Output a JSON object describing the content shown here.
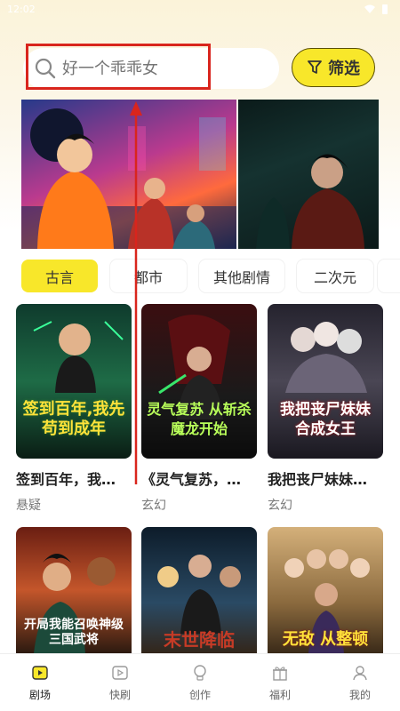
{
  "status": {
    "time": "12:02"
  },
  "search": {
    "placeholder": "好一个乖乖女"
  },
  "filter": {
    "label": "筛选"
  },
  "colors": {
    "accent": "#f8e72a",
    "highlight": "#d9251d"
  },
  "tags": [
    {
      "label": "古言",
      "active": true
    },
    {
      "label": "都市",
      "active": false
    },
    {
      "label": "其他剧情",
      "active": false
    },
    {
      "label": "二次元",
      "active": false
    }
  ],
  "cards": [
    {
      "title": "签到百年，我…",
      "genre": "悬疑",
      "cover_text": "签到百年,我先苟到成年"
    },
    {
      "title": "《灵气复苏，…",
      "genre": "玄幻",
      "cover_text": "灵气复苏 从斩杀魔龙开始"
    },
    {
      "title": "我把丧尸妹妹…",
      "genre": "玄幻",
      "cover_text": "我把丧尸妹妹 合成女王"
    },
    {
      "title": "",
      "genre": "",
      "cover_text": "开局我能召唤神级三国武将"
    },
    {
      "title": "",
      "genre": "",
      "cover_text": "末世降临"
    },
    {
      "title": "",
      "genre": "",
      "cover_text": "无敌 从整顿"
    }
  ],
  "tabbar": [
    {
      "label": "剧场",
      "icon": "theater-icon",
      "active": true
    },
    {
      "label": "快刷",
      "icon": "play-icon",
      "active": false
    },
    {
      "label": "创作",
      "icon": "bulb-icon",
      "active": false
    },
    {
      "label": "福利",
      "icon": "gift-icon",
      "active": false
    },
    {
      "label": "我的",
      "icon": "user-icon",
      "active": false
    }
  ]
}
